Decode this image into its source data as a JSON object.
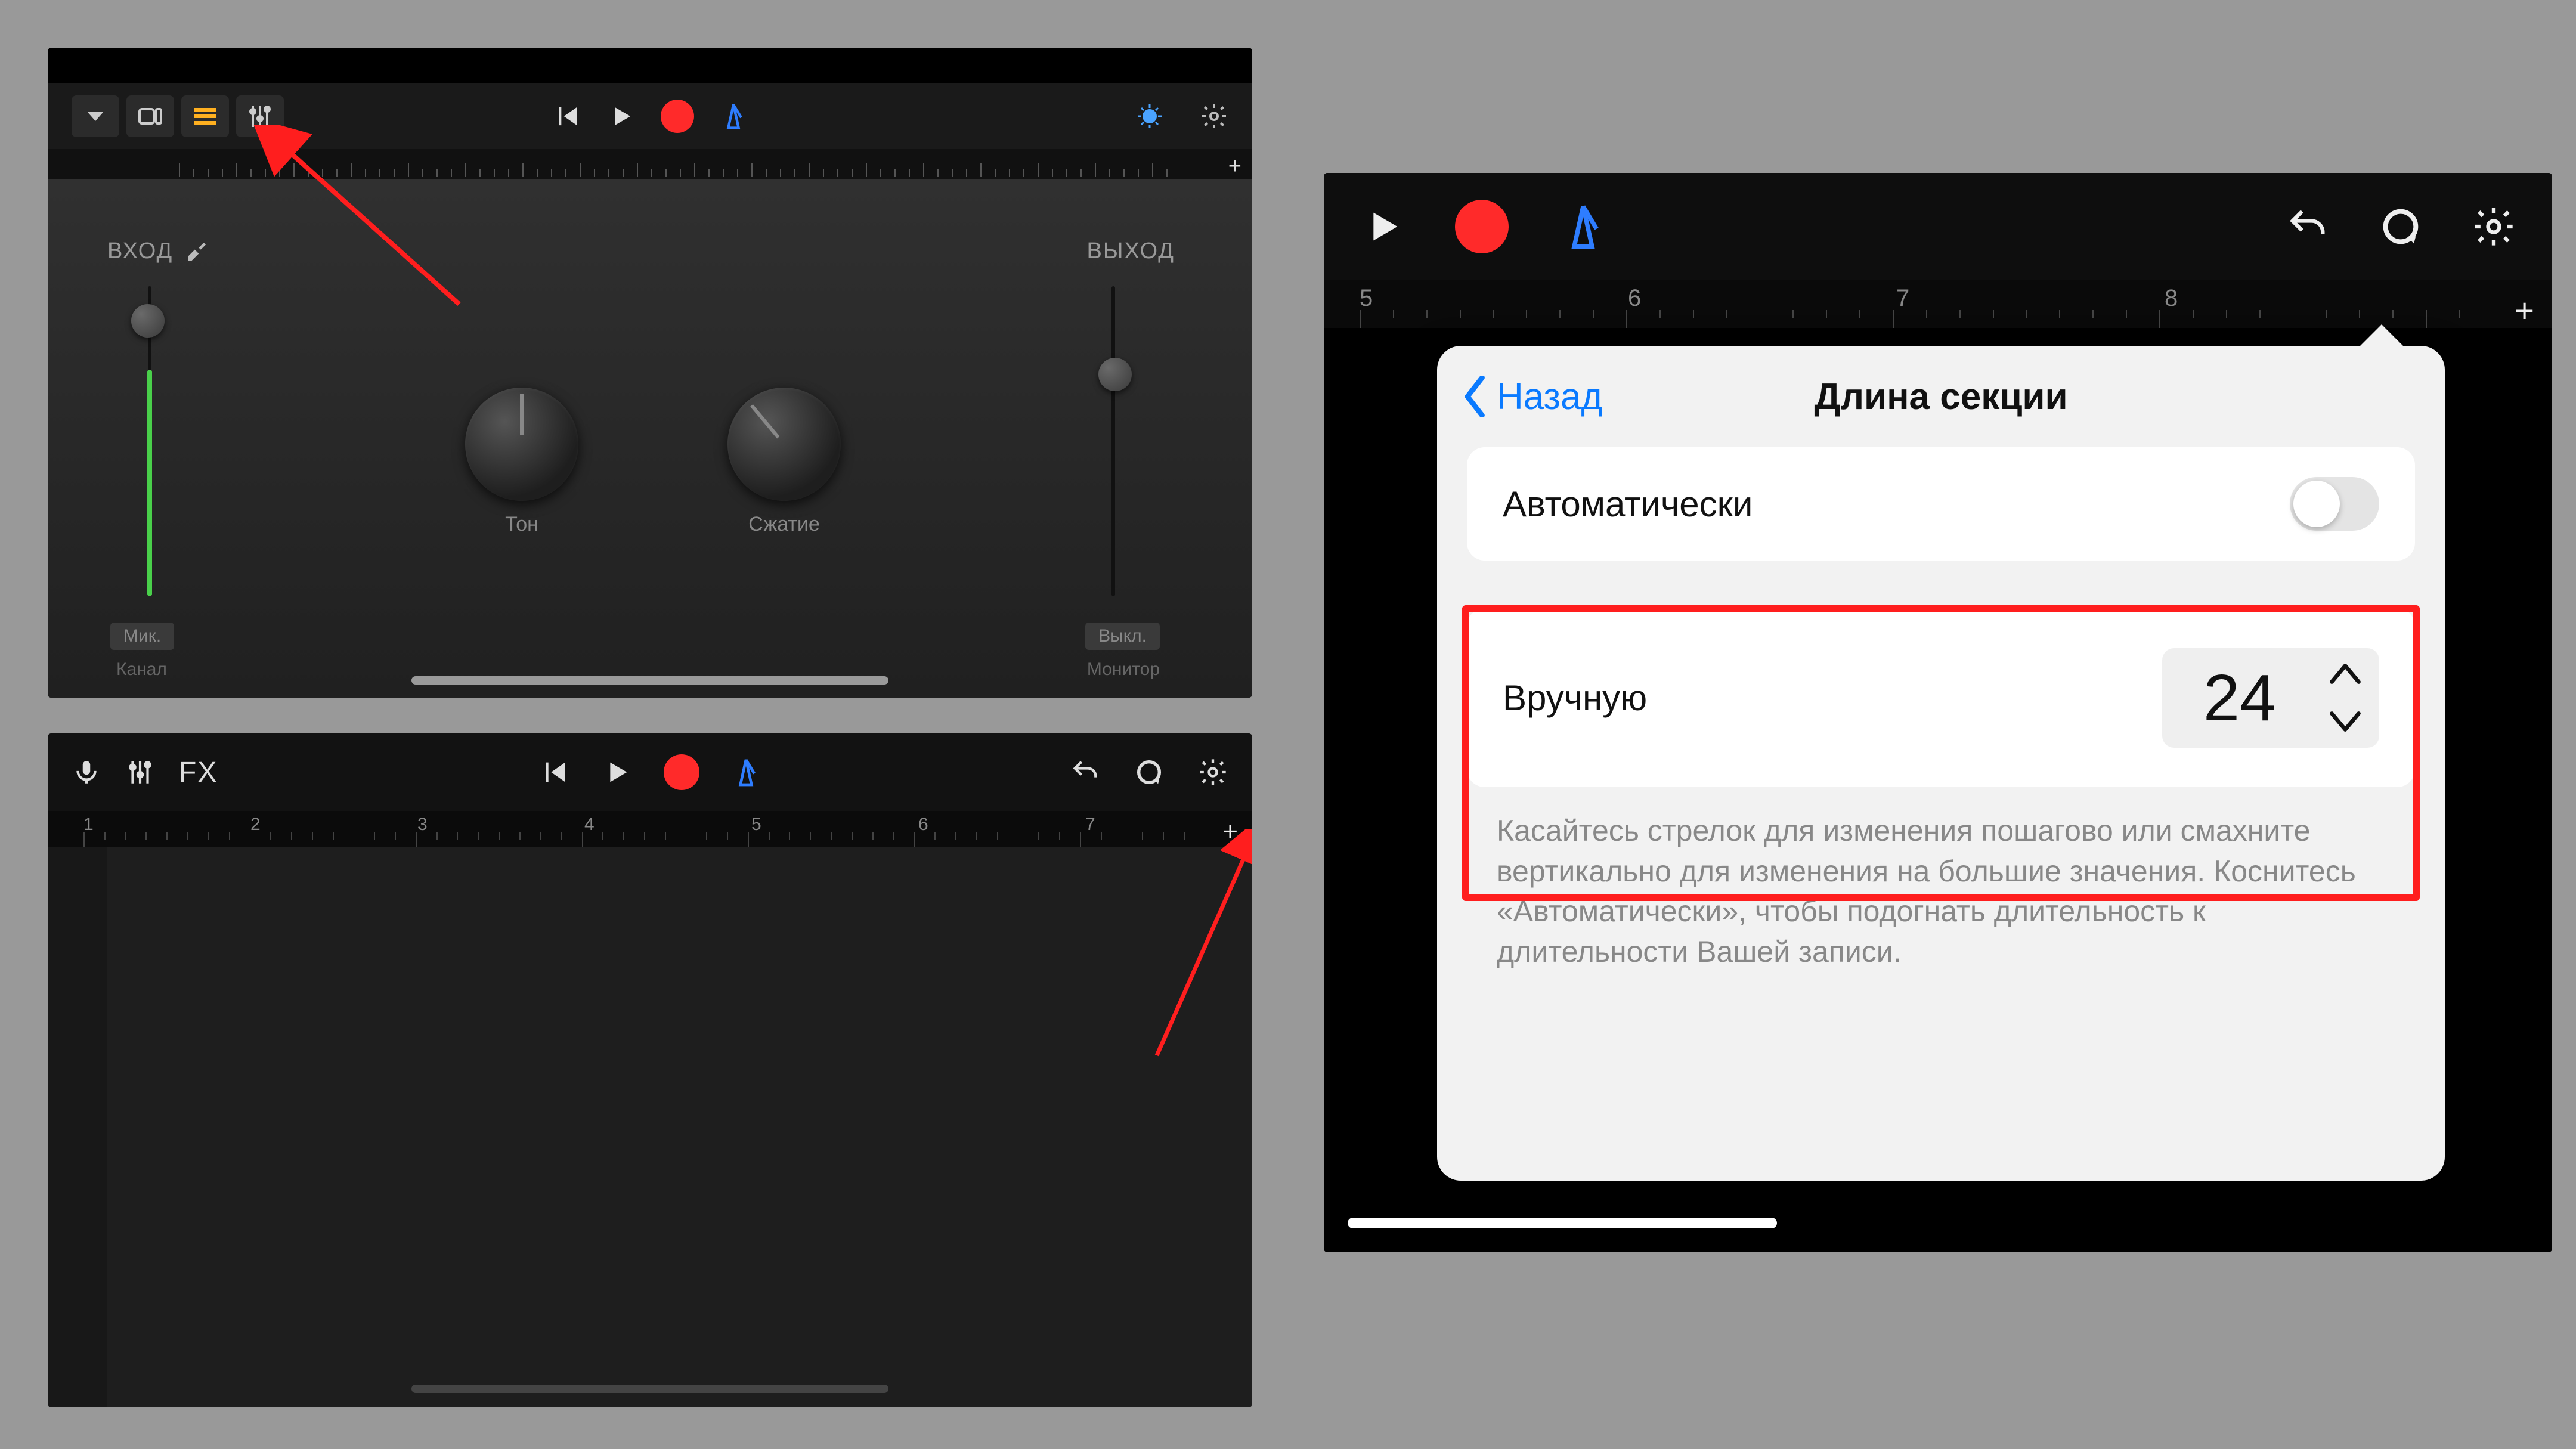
{
  "panel1": {
    "input_label": "ВХОД",
    "output_label": "ВЫХОД",
    "knob_tone_label": "Тон",
    "knob_comp_label": "Сжатие",
    "btn_mic": "Мик.",
    "btn_off": "Выкл.",
    "lbl_channel": "Канал",
    "lbl_monitor": "Монитор"
  },
  "panel2": {
    "fx_label": "FX",
    "ruler_numbers": [
      "1",
      "2",
      "3",
      "4",
      "5",
      "6",
      "7"
    ]
  },
  "panel3": {
    "back_label": "Назад",
    "title": "Длина секции",
    "auto_label": "Автоматически",
    "manual_label": "Вручную",
    "manual_value": "24",
    "hint": "Касайтесь стрелок для изменения пошагово или смахните вертикально для изменения на большие значения. Коснитесь «Автоматически», чтобы подогнать длительность к длительности Вашей записи.",
    "ruler_numbers": [
      "5",
      "6",
      "7",
      "8"
    ]
  }
}
